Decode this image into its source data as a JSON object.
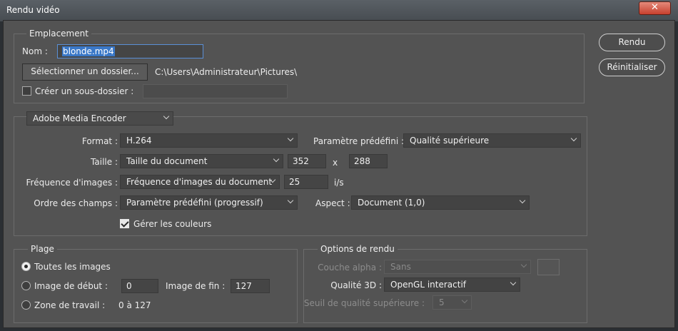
{
  "window": {
    "title": "Rendu vidéo",
    "close_glyph": "✕"
  },
  "emplacement": {
    "legend": "Emplacement",
    "nom_label": "Nom :",
    "nom_value": "blonde.mp4",
    "select_folder_button": "Sélectionner un dossier...",
    "folder_path": "C:\\Users\\Administrateur\\Pictures\\",
    "subfolder_label": "Créer un sous-dossier :",
    "subfolder_checked": false,
    "subfolder_value": ""
  },
  "encoder": {
    "renderer": "Adobe Media Encoder",
    "format_label": "Format :",
    "format_value": "H.264",
    "preset_label": "Paramètre prédéfini :",
    "preset_value": "Qualité supérieure",
    "size_label": "Taille :",
    "size_value": "Taille du document",
    "width": "352",
    "x_sep": "x",
    "height": "288",
    "framerate_label": "Fréquence d'images :",
    "framerate_value": "Fréquence d'images du document",
    "fps": "25",
    "fps_unit": "i/s",
    "field_order_label": "Ordre des champs :",
    "field_order_value": "Paramètre prédéfini (progressif)",
    "aspect_label": "Aspect :",
    "aspect_value": "Document (1,0)",
    "color_mgmt_label": "Gérer les couleurs",
    "color_mgmt_checked": true
  },
  "plage": {
    "legend": "Plage",
    "all_frames_label": "Toutes les images",
    "start_frame_label": "Image de début :",
    "start_frame_value": "0",
    "end_frame_label": "Image de fin :",
    "end_frame_value": "127",
    "work_area_label": "Zone de travail :",
    "work_area_value": "0 à 127",
    "selected": "all"
  },
  "options": {
    "legend": "Options de rendu",
    "alpha_label": "Couche alpha :",
    "alpha_value": "Sans",
    "quality3d_label": "Qualité 3D :",
    "quality3d_value": "OpenGL interactif",
    "threshold_label": "Seuil de qualité supérieure :",
    "threshold_value": "5"
  },
  "actions": {
    "render_button": "Rendu",
    "reset_button": "Réinitialiser"
  }
}
